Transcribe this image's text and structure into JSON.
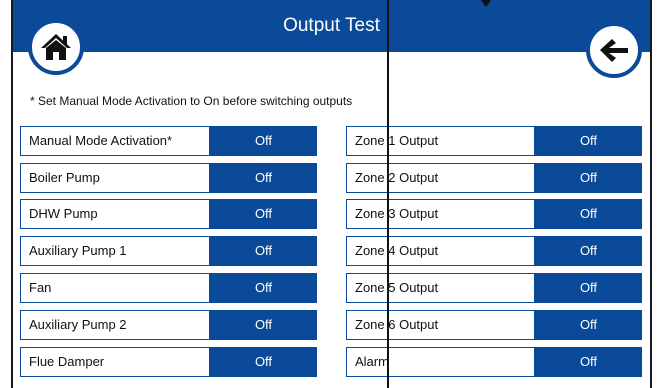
{
  "header": {
    "title": "Output Test",
    "home_icon": "home-icon",
    "back_icon": "arrow-left-icon"
  },
  "note": "* Set Manual Mode Activation to On before switching outputs",
  "colors": {
    "brand": "#0b4a99",
    "text": "#111111",
    "background": "#ffffff"
  },
  "left_outputs": [
    {
      "label": "Manual Mode Activation*",
      "state": "Off"
    },
    {
      "label": "Boiler Pump",
      "state": "Off"
    },
    {
      "label": "DHW Pump",
      "state": "Off"
    },
    {
      "label": "Auxiliary Pump 1",
      "state": "Off"
    },
    {
      "label": "Fan",
      "state": "Off"
    },
    {
      "label": "Auxiliary Pump 2",
      "state": "Off"
    },
    {
      "label": "Flue Damper",
      "state": "Off"
    }
  ],
  "right_outputs": [
    {
      "label": "Zone 1 Output",
      "state": "Off"
    },
    {
      "label": "Zone 2 Output",
      "state": "Off"
    },
    {
      "label": "Zone 3 Output",
      "state": "Off"
    },
    {
      "label": "Zone 4 Output",
      "state": "Off"
    },
    {
      "label": "Zone 5 Output",
      "state": "Off"
    },
    {
      "label": "Zone 6 Output",
      "state": "Off"
    },
    {
      "label": "Alarm",
      "state": "Off"
    }
  ]
}
